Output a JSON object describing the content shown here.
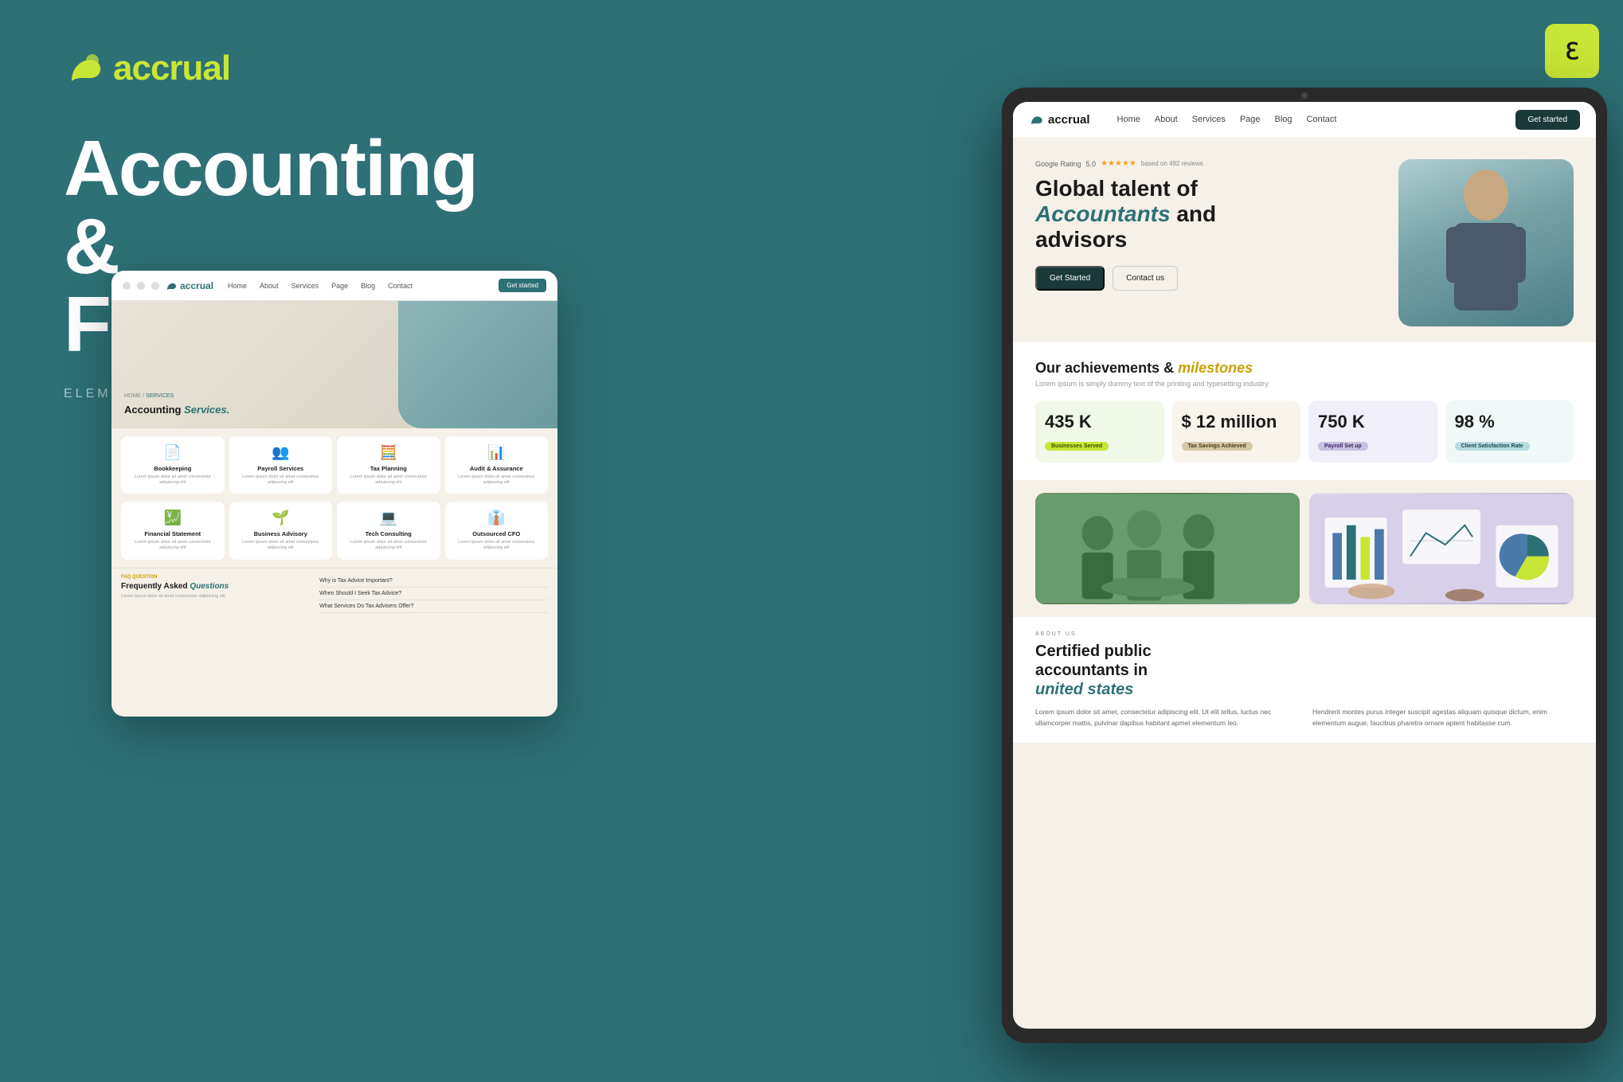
{
  "background": {
    "color": "#2d7075"
  },
  "elementor_badge": {
    "icon": "E",
    "label": "elementor-icon"
  },
  "left": {
    "logo": {
      "text": "accrual",
      "icon_alt": "accrual logo"
    },
    "heading": "Accounting &\nFinance",
    "subtitle": "Elementor Pro Template Kit"
  },
  "small_mockup": {
    "nav": {
      "logo": "accrual",
      "links": [
        "Home",
        "About",
        "Services",
        "Page",
        "Blog",
        "Contact"
      ],
      "cta": "Get started"
    },
    "hero": {
      "breadcrumb": "HOME / SERVICES",
      "title": "Accounting",
      "title_italic": "Services.",
      "image_alt": "laptop with charts"
    },
    "services": [
      {
        "icon": "📄",
        "name": "Bookkeeping",
        "desc": "Lorem ipsum dolor sit amet consectetur adipiscing elit"
      },
      {
        "icon": "👥",
        "name": "Payroll Services",
        "desc": "Lorem ipsum dolor sit amet consectetur adipiscing elit"
      },
      {
        "icon": "🧮",
        "name": "Tax Planning",
        "desc": "Lorem ipsum dolor sit amet consectetur adipiscing elit"
      },
      {
        "icon": "📊",
        "name": "Audit & Assurance",
        "desc": "Lorem ipsum dolor sit amet consectetur adipiscing elit"
      },
      {
        "icon": "💹",
        "name": "Financial Statement",
        "desc": "Lorem ipsum dolor sit amet consectetur adipiscing elit"
      },
      {
        "icon": "🌱",
        "name": "Business Advisory",
        "desc": "Lorem ipsum dolor sit amet consectetur adipiscing elit"
      },
      {
        "icon": "💻",
        "name": "Tech Consulting",
        "desc": "Lorem ipsum dolor sit amet consectetur adipiscing elit"
      },
      {
        "icon": "👔",
        "name": "Outsourced CFO",
        "desc": "Lorem ipsum dolor sit amet consectetur adipiscing elit"
      }
    ],
    "faq": {
      "label": "FAQ QUESTION",
      "title": "Frequently Asked",
      "title_em": "Questions",
      "desc": "Lorem ipsum dolor sit amet consectetur adipiscing elit",
      "questions": [
        "Why is Tax Advice Important?",
        "When Should I Seek Tax Advice?",
        "What Services Do Tax Advisers Offer?"
      ]
    }
  },
  "tablet_mockup": {
    "nav": {
      "logo": "accrual",
      "links": [
        "Home",
        "About",
        "Services",
        "Page",
        "Blog",
        "Contact"
      ],
      "cta": "Get started"
    },
    "hero": {
      "google_rating_label": "Google Rating",
      "rating_value": "5.0",
      "stars": "★★★★★",
      "reviews": "based on 492 reviews",
      "title": "Global talent of",
      "title_italic": "Accountants",
      "title_end": "and advisors",
      "btn_primary": "Get Started",
      "btn_secondary": "Contact us"
    },
    "achievements": {
      "title": "Our achievements &",
      "title_em": "milestones",
      "desc": "Lorem ipsum is simply dummy text of the printing and typesetting industry.",
      "stats": [
        {
          "number": "435 K",
          "label": "Businesses Served",
          "type": "green"
        },
        {
          "number": "$ 12 million",
          "label": "Tax Savings Achieved",
          "type": "beige"
        },
        {
          "number": "750 K",
          "label": "Payroll Set up",
          "type": "purple"
        },
        {
          "number": "98 %",
          "label": "Client Satisfaction Rate",
          "type": "light"
        }
      ]
    },
    "photos": [
      {
        "alt": "team meeting handshake",
        "type": "meeting"
      },
      {
        "alt": "financial charts documents",
        "type": "charts"
      }
    ],
    "about": {
      "label": "ABOUT US",
      "title_line1": "Certified public",
      "title_line2": "accountants in",
      "title_em": "united states",
      "text1": "Lorem ipsum dolor sit amet, consectetur adipiscing elit. Ut elit tellus, luctus nec ullamcorper mattis, pulvinar dapibus habitant apmet elementum leo.",
      "text2": "Hendrerit montes purus integer suscipit agestas aliquam quisque dictum, enim elementum augue, faucibus pharetra ornare aptent habitasse cum."
    }
  }
}
